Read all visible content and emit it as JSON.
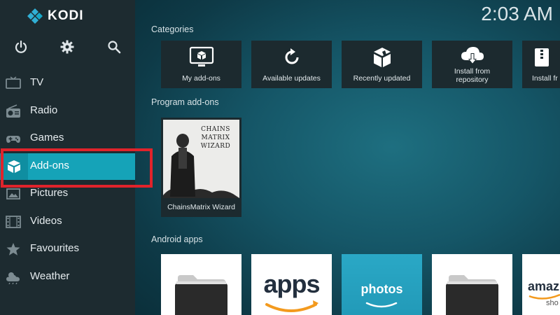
{
  "app": {
    "name": "KODI"
  },
  "clock": "2:03 AM",
  "sidebar": {
    "top_icons": [
      "power-icon",
      "gear-icon",
      "search-icon"
    ],
    "items": [
      {
        "label": "TV",
        "icon": "tv-icon"
      },
      {
        "label": "Radio",
        "icon": "radio-icon"
      },
      {
        "label": "Games",
        "icon": "gamepad-icon"
      },
      {
        "label": "Add-ons",
        "icon": "addons-box-icon",
        "active": true
      },
      {
        "label": "Pictures",
        "icon": "pictures-icon"
      },
      {
        "label": "Videos",
        "icon": "film-icon"
      },
      {
        "label": "Favourites",
        "icon": "star-icon"
      },
      {
        "label": "Weather",
        "icon": "weather-icon"
      }
    ]
  },
  "categories": {
    "title": "Categories",
    "tiles": [
      {
        "label": "My add-ons",
        "icon": "monitor-box-icon"
      },
      {
        "label": "Available updates",
        "icon": "refresh-icon"
      },
      {
        "label": "Recently updated",
        "icon": "open-box-icon"
      },
      {
        "label_line1": "Install from",
        "label_line2": "repository",
        "icon": "cloud-download-icon"
      },
      {
        "label": "Install fr",
        "icon": "zip-icon"
      }
    ]
  },
  "program_addons": {
    "title": "Program add-ons",
    "items": [
      {
        "label": "ChainsMatrix Wizard",
        "thumb_line1": "CHAINS",
        "thumb_line2": "MATRIX",
        "thumb_line3": "WIZARD"
      }
    ]
  },
  "android_apps": {
    "title": "Android apps",
    "items": [
      {
        "label": "",
        "icon": "folder-icon"
      },
      {
        "label": "apps",
        "icon": "amazon-appstore-icon"
      },
      {
        "label": "photos",
        "icon": "amazon-photos-icon"
      },
      {
        "label": "",
        "icon": "folder-icon"
      },
      {
        "label": "amaz",
        "sub": "sho",
        "icon": "amazon-shopping-icon"
      }
    ]
  },
  "colors": {
    "accent": "#15a3b8",
    "sidebar_bg": "#1d2b30",
    "tile_bg": "#1c2a2f",
    "highlight": "#e0232b"
  }
}
